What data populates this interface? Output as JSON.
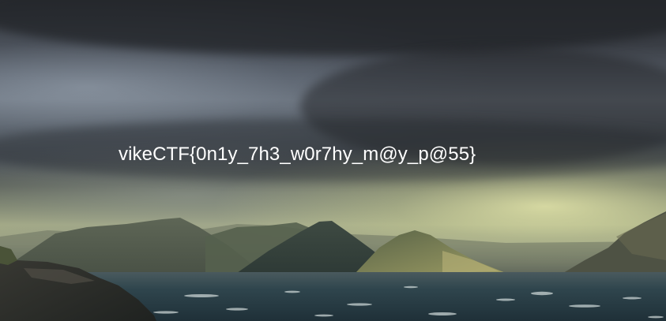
{
  "image": {
    "caption_text": "vikeCTF{0n1y_7h3_w0r7hy_m@y_p@55}"
  },
  "colors": {
    "caption": "#ffffff",
    "sky_dark": "#2e3136",
    "horizon_glow": "#e4e6aa",
    "sea": "#2f4047"
  }
}
